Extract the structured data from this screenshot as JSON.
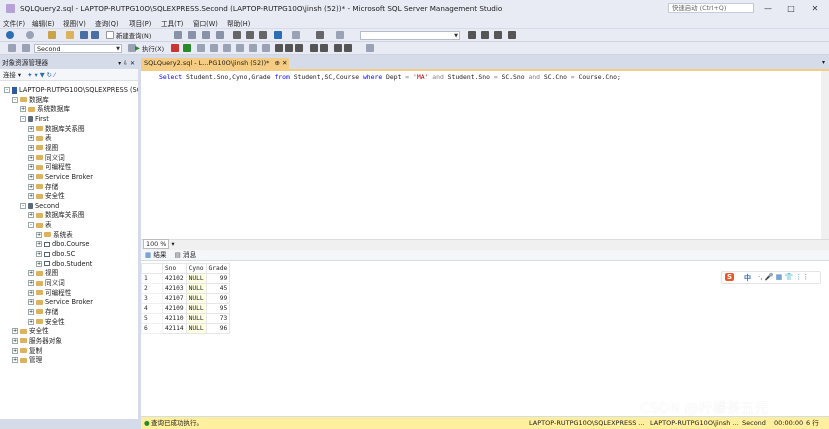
{
  "window": {
    "title": "SQLQuery2.sql - LAPTOP-RUTPG10O\\SQLEXPRESS.Second (LAPTOP-RUTPG10O\\jinsh (52))* - Microsoft SQL Server Management Studio",
    "quick_launch_placeholder": "快速启动 (Ctrl+Q)",
    "minimize": "—",
    "maximize": "□",
    "close": "✕"
  },
  "menu": [
    "文件(F)",
    "编辑(E)",
    "视图(V)",
    "查询(Q)",
    "项目(P)",
    "工具(T)",
    "窗口(W)",
    "帮助(H)"
  ],
  "toolbar": {
    "new_query": "新建查询(N)",
    "database": "Second",
    "execute": "执行(X)"
  },
  "object_explorer": {
    "title": "对象资源管理器",
    "header_icons": "▾ ⇩ ✕",
    "connect": "连接 ▾",
    "tree": [
      {
        "level": 0,
        "icon": "server",
        "label": "LAPTOP-RUTPG10O\\SQLEXPRESS (SQL",
        "exp": "-"
      },
      {
        "level": 1,
        "icon": "folder",
        "label": "数据库",
        "exp": "-"
      },
      {
        "level": 2,
        "icon": "folder",
        "label": "系统数据库",
        "exp": "+"
      },
      {
        "level": 2,
        "icon": "db",
        "label": "First",
        "exp": "-"
      },
      {
        "level": 3,
        "icon": "folder",
        "label": "数据库关系图",
        "exp": "+"
      },
      {
        "level": 3,
        "icon": "folder",
        "label": "表",
        "exp": "+"
      },
      {
        "level": 3,
        "icon": "folder",
        "label": "视图",
        "exp": "+"
      },
      {
        "level": 3,
        "icon": "folder",
        "label": "同义词",
        "exp": "+"
      },
      {
        "level": 3,
        "icon": "folder",
        "label": "可编程性",
        "exp": "+"
      },
      {
        "level": 3,
        "icon": "folder",
        "label": "Service Broker",
        "exp": "+"
      },
      {
        "level": 3,
        "icon": "folder",
        "label": "存储",
        "exp": "+"
      },
      {
        "level": 3,
        "icon": "folder",
        "label": "安全性",
        "exp": "+"
      },
      {
        "level": 2,
        "icon": "db",
        "label": "Second",
        "exp": "-"
      },
      {
        "level": 3,
        "icon": "folder",
        "label": "数据库关系图",
        "exp": "+"
      },
      {
        "level": 3,
        "icon": "folder",
        "label": "表",
        "exp": "-"
      },
      {
        "level": 4,
        "icon": "folder",
        "label": "系统表",
        "exp": "+"
      },
      {
        "level": 4,
        "icon": "table",
        "label": "dbo.Course",
        "exp": "+"
      },
      {
        "level": 4,
        "icon": "table",
        "label": "dbo.SC",
        "exp": "+"
      },
      {
        "level": 4,
        "icon": "table",
        "label": "dbo.Student",
        "exp": "+"
      },
      {
        "level": 3,
        "icon": "folder",
        "label": "视图",
        "exp": "+"
      },
      {
        "level": 3,
        "icon": "folder",
        "label": "同义词",
        "exp": "+"
      },
      {
        "level": 3,
        "icon": "folder",
        "label": "可编程性",
        "exp": "+"
      },
      {
        "level": 3,
        "icon": "folder",
        "label": "Service Broker",
        "exp": "+"
      },
      {
        "level": 3,
        "icon": "folder",
        "label": "存储",
        "exp": "+"
      },
      {
        "level": 3,
        "icon": "folder",
        "label": "安全性",
        "exp": "+"
      },
      {
        "level": 1,
        "icon": "folder",
        "label": "安全性",
        "exp": "+"
      },
      {
        "level": 1,
        "icon": "folder",
        "label": "服务器对象",
        "exp": "+"
      },
      {
        "level": 1,
        "icon": "folder",
        "label": "复制",
        "exp": "+"
      },
      {
        "level": 1,
        "icon": "folder",
        "label": "管理",
        "exp": "+"
      }
    ]
  },
  "editor": {
    "tab_label": "SQLQuery2.sql - L...PG10O\\jinsh (52))*",
    "tab_icons": "⊕ ✕",
    "sql_parts": [
      {
        "t": "Select ",
        "c": "kw"
      },
      {
        "t": "Student.Sno,Cyno,Grade ",
        "c": ""
      },
      {
        "t": "from ",
        "c": "kw"
      },
      {
        "t": "Student,SC,Course ",
        "c": ""
      },
      {
        "t": "where ",
        "c": "kw"
      },
      {
        "t": "Dept ",
        "c": ""
      },
      {
        "t": "= ",
        "c": "gray"
      },
      {
        "t": "'MA' ",
        "c": "str"
      },
      {
        "t": "and ",
        "c": "gray"
      },
      {
        "t": "Student.Sno ",
        "c": ""
      },
      {
        "t": "= ",
        "c": "gray"
      },
      {
        "t": "SC.Sno ",
        "c": ""
      },
      {
        "t": "and ",
        "c": "gray"
      },
      {
        "t": "SC.Cno ",
        "c": ""
      },
      {
        "t": "= ",
        "c": "gray"
      },
      {
        "t": "Course.Cno;",
        "c": ""
      }
    ],
    "zoom": "100 %"
  },
  "results": {
    "tab_results": "结果",
    "tab_messages": "消息",
    "columns": [
      "Sno",
      "Cyno",
      "Grade"
    ],
    "rows": [
      [
        "1",
        "42102",
        "NULL",
        "99"
      ],
      [
        "2",
        "42103",
        "NULL",
        "45"
      ],
      [
        "3",
        "42107",
        "NULL",
        "99"
      ],
      [
        "4",
        "42109",
        "NULL",
        "95"
      ],
      [
        "5",
        "42110",
        "NULL",
        "73"
      ],
      [
        "6",
        "42114",
        "NULL",
        "96"
      ]
    ]
  },
  "ime_toolbar": {
    "logo": "S",
    "lang": "中",
    "items": "·, 🎤 ▦ 👕 ⋮⋮"
  },
  "status": {
    "message": "查询已成功执行。",
    "server": "LAPTOP-RUTPG10O\\SQLEXPRESS ...",
    "user": "LAPTOP-RUTPG10O\\jinsh ...",
    "database": "Second",
    "elapsed": "00:00:00",
    "rows": "6 行"
  },
  "watermark": "CSDN @柠檬茶五元",
  "colors": {
    "accent_tab": "#f5cc84",
    "status": "#ffef9e",
    "chrome": "#d6dbe9"
  }
}
